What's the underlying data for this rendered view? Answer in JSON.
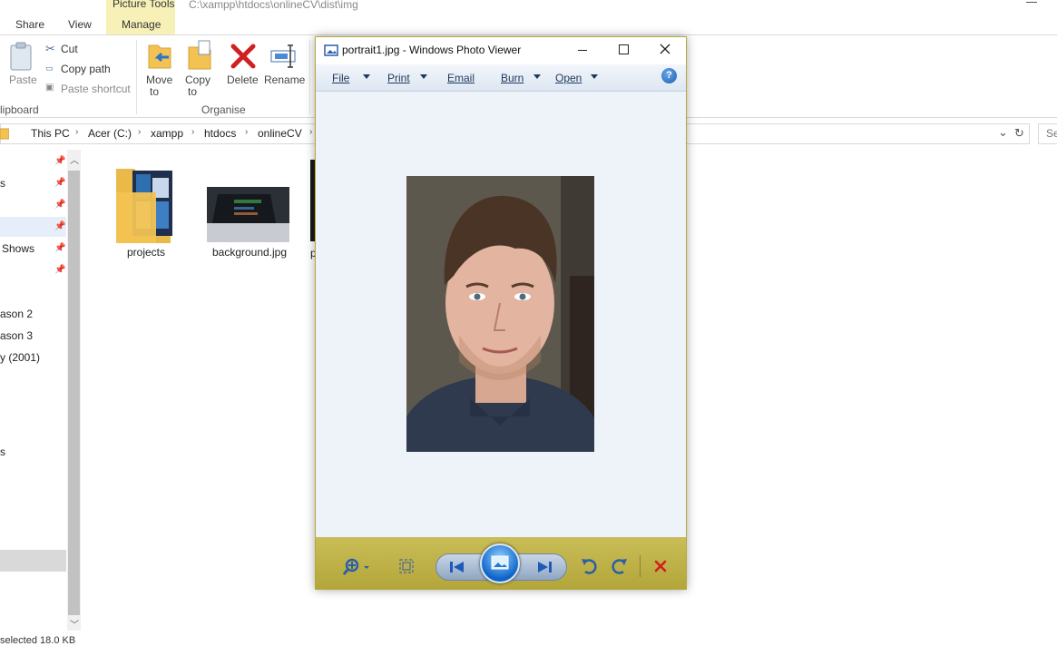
{
  "explorer": {
    "context_tab": "Picture Tools",
    "path_title": "C:\\xampp\\htdocs\\onlineCV\\dist\\img",
    "tabs": [
      "Share",
      "View",
      "Manage"
    ],
    "clipboard": {
      "paste": "Paste",
      "cut": "Cut",
      "copy_path": "Copy path",
      "paste_shortcut": "Paste shortcut",
      "group": "lipboard"
    },
    "organise": {
      "move_to": "Move",
      "move_to2": "to",
      "copy_to": "Copy",
      "copy_to2": "to",
      "delete": "Delete",
      "rename": "Rename",
      "group": "Organise"
    },
    "breadcrumb": [
      "This PC",
      "Acer (C:)",
      "xampp",
      "htdocs",
      "onlineCV"
    ],
    "search_placeholder": "Se",
    "nav_items": [
      "s",
      "Shows",
      "ason 2",
      "ason 3",
      "y (2001)",
      "s"
    ],
    "files": [
      "projects",
      "background.jpg",
      "p"
    ],
    "status": "selected  18.0 KB"
  },
  "viewer": {
    "title": "portrait1.jpg - Windows Photo Viewer",
    "menus": [
      "File",
      "Print",
      "Email",
      "Burn",
      "Open"
    ],
    "help": "?"
  },
  "colors": {
    "viewer_border": "#b5a838",
    "viewer_toolbar": "#b3a63a",
    "delete_red": "#d11f1f"
  }
}
